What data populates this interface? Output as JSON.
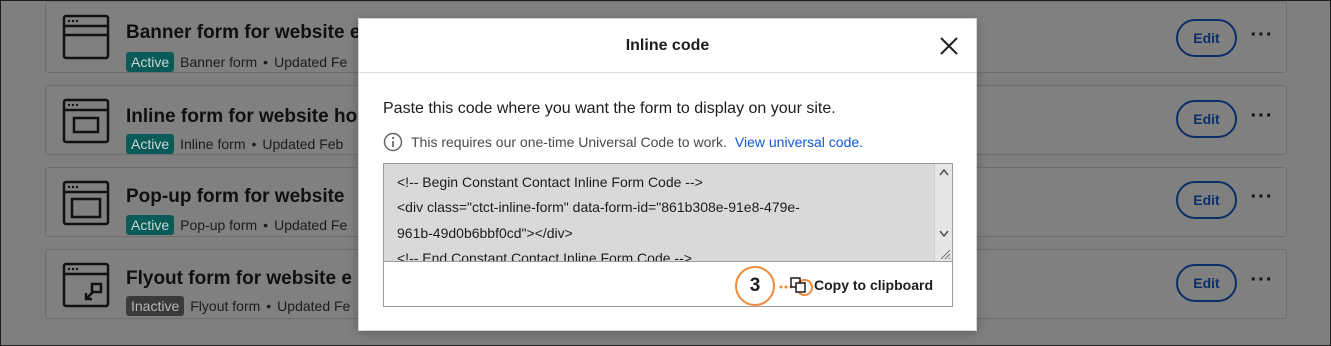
{
  "forms": [
    {
      "title": "Banner form for website e",
      "status": "Active",
      "type": "Banner form",
      "updated": "Updated Fe",
      "edit_label": "Edit",
      "more_label": "···"
    },
    {
      "title": "Inline form for website ho",
      "status": "Active",
      "type": "Inline form",
      "updated": "Updated Feb",
      "edit_label": "Edit",
      "more_label": "···"
    },
    {
      "title": "Pop-up form for website",
      "status": "Active",
      "type": "Pop-up form",
      "updated": "Updated Fe",
      "edit_label": "Edit",
      "more_label": "···"
    },
    {
      "title": "Flyout form for website e",
      "status": "Inactive",
      "type": "Flyout form",
      "updated": "Updated Fe",
      "edit_label": "Edit",
      "more_label": "···"
    }
  ],
  "meta_separator": "•",
  "modal": {
    "title": "Inline code",
    "instruction": "Paste this code where you want the form to display on your site.",
    "note_text": "This requires our one-time Universal Code to work.",
    "note_link": "View universal code.",
    "code_lines": [
      "<!-- Begin Constant Contact Inline Form Code -->",
      "<div class=\"ctct-inline-form\" data-form-id=\"861b308e-91e8-479e-",
      "961b-49d0b6bbf0cd\"></div>",
      "<!-- End Constant Contact Inline Form Code -->"
    ],
    "copy_label": "Copy to clipboard",
    "step_number": "3"
  },
  "colors": {
    "accent_orange": "#f08a3a",
    "link_blue": "#1059d1",
    "active_badge": "#0a5a57",
    "edit_outline": "#0c2e66"
  },
  "icons": {
    "row_icons": [
      "banner-form-icon",
      "inline-form-icon",
      "popup-form-icon",
      "flyout-form-icon"
    ],
    "close": "close-icon",
    "info": "info-icon",
    "copy": "copy-icon"
  }
}
